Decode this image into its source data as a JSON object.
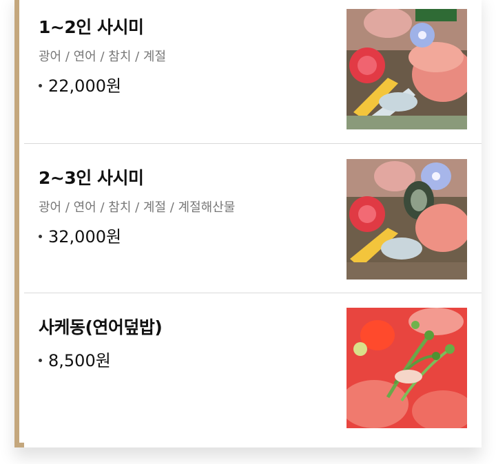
{
  "menu": {
    "items": [
      {
        "name": "1~2인 사시미",
        "description": "광어 / 연어 / 참치 / 계절",
        "price": "22,000원",
        "image_icon": "sashimi-platter-photo"
      },
      {
        "name": "2~3인 사시미",
        "description": "광어 / 연어 / 참치 / 계절 / 계절해산물",
        "price": "32,000원",
        "image_icon": "sashimi-platter-seafood-photo"
      },
      {
        "name": "사케동(연어덮밥)",
        "price": "8,500원",
        "image_icon": "salmon-rice-bowl-photo"
      }
    ]
  },
  "colors": {
    "frame_border": "#c4a77d",
    "divider": "#d9d9d9"
  }
}
